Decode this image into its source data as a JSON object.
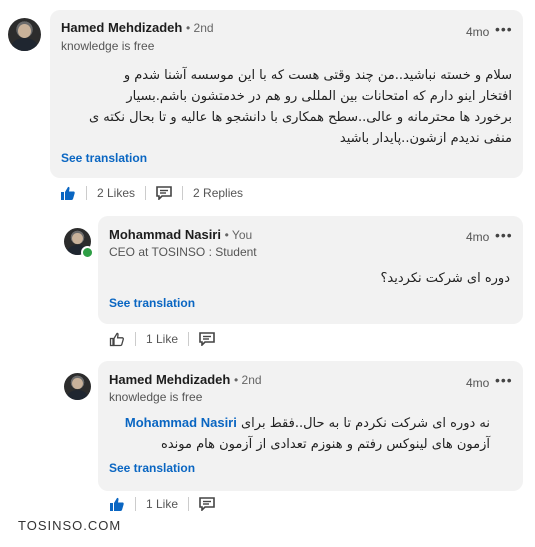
{
  "comment1": {
    "author": "Hamed Mehdizadeh",
    "degree": "• 2nd",
    "headline": "knowledge is free",
    "time": "4mo",
    "lines": [
      "سلام و خسته نباشید..من چند وقتی هست که با این موسسه آشنا شدم و",
      "افتخار اینو دارم که امتحانات بین المللی رو هم در خدمتشون باشم.بسیار",
      "برخورد ها محترمانه و عالی..سطح همکاری با دانشجو ها عالیه و تا بحال نکته ی",
      "منفی ندیدم ازشون..پایدار باشید"
    ],
    "see_translation": "See translation",
    "likes": "2 Likes",
    "replies": "2 Replies"
  },
  "reply1": {
    "author": "Mohammad Nasiri",
    "degree": "• You",
    "headline": "CEO at TOSINSO : Student",
    "time": "4mo",
    "text": "دوره ای شرکت نکردید؟",
    "see_translation": "See translation",
    "likes": "1 Like"
  },
  "reply2": {
    "author": "Hamed Mehdizadeh",
    "degree": "• 2nd",
    "headline": "knowledge is free",
    "time": "4mo",
    "mention": "Mohammad Nasiri",
    "line1": "نه دوره ای شرکت نکردم تا به حال..فقط برای",
    "line2": "آزمون های لینوکس رفتم و هنوزم تعدادی از آزمون هام مونده",
    "see_translation": "See translation",
    "likes": "1 Like"
  },
  "watermark": "TOSINSO.COM",
  "icons": {
    "more": "ellipsis-icon",
    "like_filled": "thumbs-up-filled-icon",
    "like_outline": "thumbs-up-outline-icon",
    "reply": "comment-icon"
  },
  "colors": {
    "card_bg": "#f2f2f2",
    "link": "#0a66c2",
    "presence": "#2e9e45"
  }
}
